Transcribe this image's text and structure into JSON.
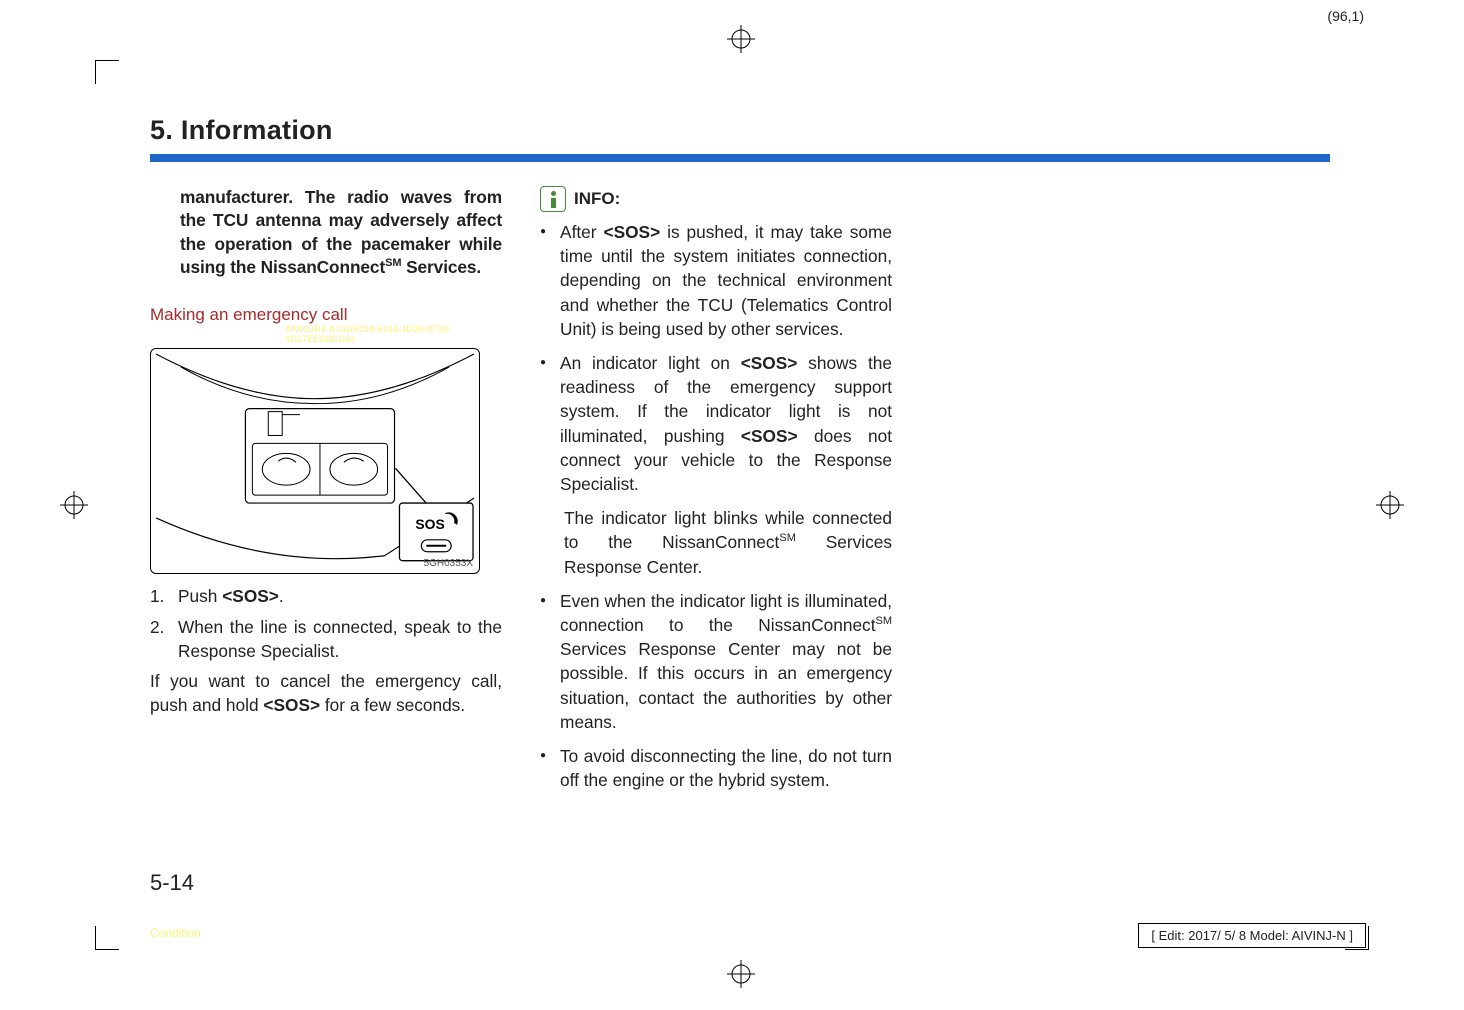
{
  "meta": {
    "topright": "(96,1)",
    "editbox": "[ Edit: 2017/ 5/ 8    Model:  AIVINJ-N ]",
    "condition": "Condition:",
    "pagenum": "5-14"
  },
  "chapter": "5. Information",
  "col1": {
    "bold_note_html": "manufacturer. The radio waves from the TCU antenna may adversely affect the operation of the pacemaker while using the NissanConnect",
    "bold_note_sup": "SM",
    "bold_note_tail": " Services.",
    "subheading": "Making an emergency call",
    "guid": "AIVINJN1-A74O9108-5244-4D39-8759-9D27EED8CD91",
    "figlabel": "5GH0353X",
    "sos": "SOS",
    "step1_num": "1.",
    "step1": "Push ",
    "step1_b": "<SOS>",
    "step1_tail": ".",
    "step2_num": "2.",
    "step2": "When the line is connected, speak to the Response Specialist.",
    "cancel_a": "If you want to cancel the emergency call, push and hold ",
    "cancel_b": "<SOS>",
    "cancel_c": " for a few seconds."
  },
  "col2": {
    "info_label": "INFO:",
    "b1_a": "After ",
    "b1_b": "<SOS>",
    "b1_c": " is pushed, it may take some time until the system initiates connection, depending on the technical environment and whether the TCU (Telematics Control Unit) is being used by other services.",
    "b2_a": "An indicator light on ",
    "b2_b": "<SOS>",
    "b2_c": " shows the readiness of the emergency support system. If the indicator light is not illuminated, pushing ",
    "b2_d": "<SOS>",
    "b2_e": " does not connect your vehicle to the Response Specialist.",
    "b2_cont_a": "The indicator light blinks while connected to the NissanConnect",
    "b2_cont_sup": "SM",
    "b2_cont_b": " Services Response Center.",
    "b3_a": "Even when the indicator light is illuminated, connection to the NissanConnect",
    "b3_sup": "SM",
    "b3_b": " Services Response Center may not be possible. If this occurs in an emergency situation, contact the authorities by other means.",
    "b4": "To avoid disconnecting the line, do not turn off the engine or the hybrid system."
  }
}
